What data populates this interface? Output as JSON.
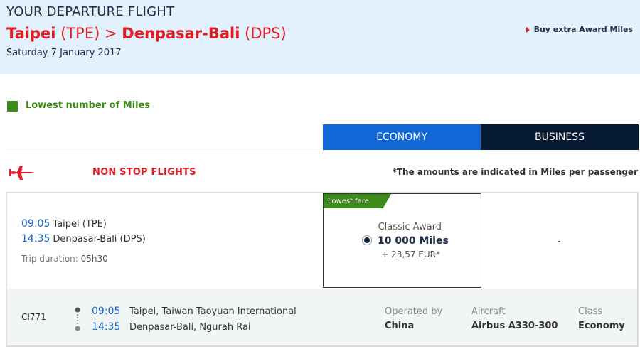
{
  "header": {
    "label": "YOUR DEPARTURE FLIGHT",
    "origin_city": "Taipei",
    "origin_code": "(TPE)",
    "separator": ">",
    "destination_city": "Denpasar-Bali",
    "destination_code": "(DPS)",
    "date": "Saturday 7 January 2017",
    "buy_extra": "Buy extra Award Miles"
  },
  "legend": {
    "label": "Lowest number of Miles",
    "color": "#3d8b1a"
  },
  "tabs": {
    "economy": "ECONOMY",
    "business": "BUSINESS"
  },
  "section": {
    "title": "NON STOP FLIGHTS",
    "note_asterisk": "*",
    "note": "The amounts are indicated in Miles per passenger"
  },
  "flight": {
    "dep_time": "09:05",
    "dep_place": "Taipei (TPE)",
    "arr_time": "14:35",
    "arr_place": "Denpasar-Bali (DPS)",
    "duration_label": "Trip duration:",
    "duration": "05h30",
    "fare": {
      "tag": "Lowest fare",
      "name": "Classic Award",
      "miles": "10 000 Miles",
      "fee": "+ 23,57 EUR*",
      "selected": true
    },
    "business_fare": "-",
    "details": {
      "code": "CI771",
      "dep_time": "09:05",
      "dep_place": "Taipei, Taiwan Taoyuan International",
      "arr_time": "14:35",
      "arr_place": "Denpasar-Bali, Ngurah Rai",
      "operated_label": "Operated by",
      "operated": "China",
      "aircraft_label": "Aircraft",
      "aircraft": "Airbus A330-300",
      "class_label": "Class",
      "class": "Economy"
    }
  },
  "colors": {
    "header_bg": "#e2f1fb",
    "accent_red": "#e31b23",
    "economy_tab": "#1167d6",
    "business_tab": "#061a33",
    "time_blue": "#1167d6"
  },
  "icons": [
    "plane-icon",
    "triangle-right-icon",
    "radio-selected-icon",
    "route-dots-icon"
  ]
}
